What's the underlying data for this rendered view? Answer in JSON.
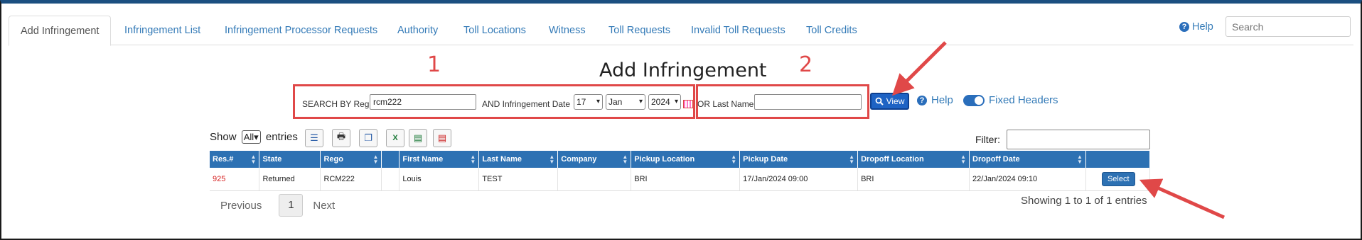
{
  "tabs": [
    {
      "label": "Add Infringement",
      "active": true
    },
    {
      "label": "Infringement List"
    },
    {
      "label": "Infringement Processor Requests"
    },
    {
      "label": "Authority"
    },
    {
      "label": "Toll Locations"
    },
    {
      "label": "Witness"
    },
    {
      "label": "Toll Requests"
    },
    {
      "label": "Invalid Toll Requests"
    },
    {
      "label": "Toll Credits"
    }
  ],
  "header": {
    "help_label": "Help",
    "search_placeholder": "Search"
  },
  "page_title": "Add Infringement",
  "search_form": {
    "search_by_rego_label": "SEARCH BY Rego",
    "rego_value": "rcm222",
    "and_date_label": "AND Infringement Date",
    "day": "17",
    "month": "Jan",
    "year": "2024",
    "or_last_name_label": "OR Last Name",
    "last_name_value": "",
    "view_label": "View",
    "help_label": "Help",
    "fixed_headers_label": "Fixed Headers",
    "fixed_headers_on": true
  },
  "annotations": {
    "number_1": "1",
    "number_2": "2",
    "accent": "#e04848"
  },
  "table_controls": {
    "show_label": "Show",
    "entries_value": "All",
    "entries_label": "entries",
    "filter_label": "Filter:",
    "tool_icons": [
      "list-icon",
      "print-icon",
      "copy-icon",
      "excel-icon",
      "csv-icon",
      "pdf-icon"
    ]
  },
  "table": {
    "columns": [
      "Res.#",
      "State",
      "Rego",
      "",
      "First Name",
      "Last Name",
      "Company",
      "Pickup Location",
      "Pickup Date",
      "Dropoff Location",
      "Dropoff Date",
      ""
    ],
    "rows": [
      {
        "res": "925",
        "state": "Returned",
        "rego": "RCM222",
        "blank": "",
        "first_name": "Louis",
        "last_name": "TEST",
        "company": "",
        "pickup_location": "BRI",
        "pickup_date": "17/Jan/2024 09:00",
        "dropoff_location": "BRI",
        "dropoff_date": "22/Jan/2024 09:10",
        "action_label": "Select"
      }
    ]
  },
  "pagination": {
    "previous_label": "Previous",
    "current_page": "1",
    "next_label": "Next",
    "info": "Showing 1 to 1 of 1 entries"
  },
  "colors": {
    "header_blue": "#2d71b3",
    "link_blue": "#337ab7",
    "res_red": "#d62020"
  }
}
